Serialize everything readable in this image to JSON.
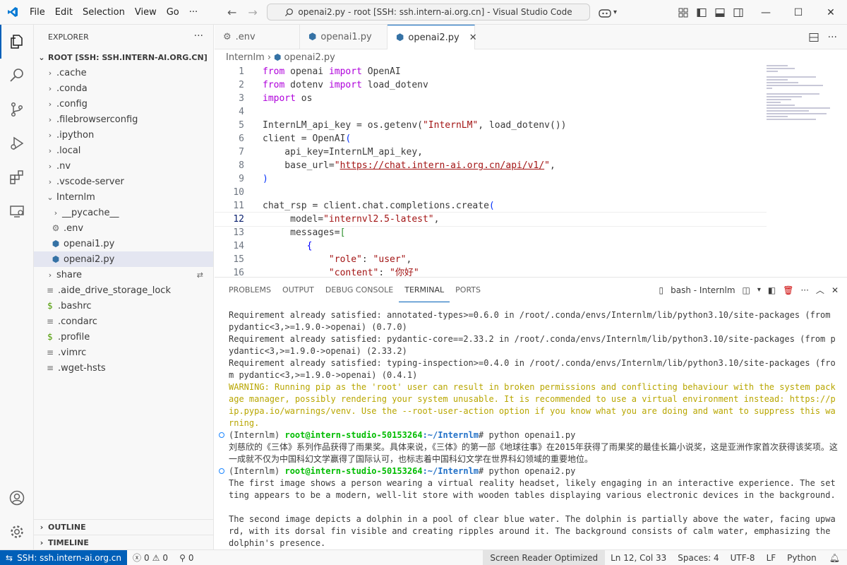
{
  "window": {
    "title": "openai2.py - root [SSH: ssh.intern-ai.org.cn] - Visual Studio Code",
    "menu": [
      "File",
      "Edit",
      "Selection",
      "View",
      "Go",
      "···"
    ]
  },
  "sidebar": {
    "header": "EXPLORER",
    "root_label": "ROOT [SSH: SSH.INTERN-AI.ORG.CN]",
    "items": [
      {
        "label": ".cache",
        "type": "folder",
        "depth": 1
      },
      {
        "label": ".conda",
        "type": "folder",
        "depth": 1
      },
      {
        "label": ".config",
        "type": "folder",
        "depth": 1
      },
      {
        "label": ".filebrowserconfig",
        "type": "folder",
        "depth": 1
      },
      {
        "label": ".ipython",
        "type": "folder",
        "depth": 1
      },
      {
        "label": ".local",
        "type": "folder",
        "depth": 1
      },
      {
        "label": ".nv",
        "type": "folder",
        "depth": 1
      },
      {
        "label": ".vscode-server",
        "type": "folder",
        "depth": 1
      },
      {
        "label": "Internlm",
        "type": "folder-open",
        "depth": 1
      },
      {
        "label": "__pycache__",
        "type": "folder",
        "depth": 2
      },
      {
        "label": ".env",
        "type": "gear-file",
        "depth": 2
      },
      {
        "label": "openai1.py",
        "type": "python",
        "depth": 2
      },
      {
        "label": "openai2.py",
        "type": "python",
        "depth": 2,
        "selected": true
      },
      {
        "label": "share",
        "type": "folder",
        "depth": 1
      },
      {
        "label": ".aide_drive_storage_lock",
        "type": "text",
        "depth": 1
      },
      {
        "label": ".bashrc",
        "type": "shell",
        "depth": 1
      },
      {
        "label": ".condarc",
        "type": "text",
        "depth": 1
      },
      {
        "label": ".profile",
        "type": "shell",
        "depth": 1
      },
      {
        "label": ".vimrc",
        "type": "text",
        "depth": 1
      },
      {
        "label": ".wget-hsts",
        "type": "text",
        "depth": 1
      }
    ],
    "outline": "OUTLINE",
    "timeline": "TIMELINE"
  },
  "tabs": [
    {
      "label": ".env",
      "icon": "gear-icon"
    },
    {
      "label": "openai1.py",
      "icon": "python-icon"
    },
    {
      "label": "openai2.py",
      "icon": "python-icon",
      "active": true
    }
  ],
  "breadcrumb": {
    "folder": "Internlm",
    "file": "openai2.py"
  },
  "code": {
    "current_line": 12
  },
  "panel": {
    "tabs": [
      "PROBLEMS",
      "OUTPUT",
      "DEBUG CONSOLE",
      "TERMINAL",
      "PORTS"
    ],
    "active_tab": "TERMINAL",
    "terminal_name": "bash - Internlm"
  },
  "terminal": {
    "lines": [
      "Requirement already satisfied: annotated-types>=0.6.0 in /root/.conda/envs/Internlm/lib/python3.10/site-packages (from pydantic<3,>=1.9.0->openai) (0.7.0)",
      "Requirement already satisfied: pydantic-core==2.33.2 in /root/.conda/envs/Internlm/lib/python3.10/site-packages (from pydantic<3,>=1.9.0->openai) (2.33.2)",
      "Requirement already satisfied: typing-inspection>=0.4.0 in /root/.conda/envs/Internlm/lib/python3.10/site-packages (from pydantic<3,>=1.9.0->openai) (0.4.1)"
    ],
    "warning": "WARNING: Running pip as the 'root' user can result in broken permissions and conflicting behaviour with the system package manager, possibly rendering your system unusable. It is recommended to use a virtual environment instead: https://pip.pypa.io/warnings/venv. Use the --root-user-action option if you know what you are doing and want to suppress this warning.",
    "prompt_env": "(Internlm) ",
    "prompt_user": "root@intern-studio-50153264",
    "prompt_path": ":~/Internlm",
    "cmd1": "# python openai1.py",
    "out1": "刘慈欣的《三体》系列作品获得了雨果奖。具体来说，《三体》的第一部《地球往事》在2015年获得了雨果奖的最佳长篇小说奖，这是亚洲作家首次获得该奖项。这一成就不仅为中国科幻文学赢得了国际认可，也标志着中国科幻文学在世界科幻领域的重要地位。",
    "cmd2": "# python openai2.py",
    "out2a": "The first image shows a person wearing a virtual reality headset, likely engaging in an interactive experience. The setting appears to be a modern, well-lit store with wooden tables displaying various electronic devices in the background.",
    "out2b": "The second image depicts a dolphin in a pool of clear blue water. The dolphin is partially above the water, facing upward, with its dorsal fin visible and creating ripples around it. The background consists of calm water, emphasizing the dolphin's presence.",
    "cmd3": "#"
  },
  "statusbar": {
    "remote": "SSH: ssh.intern-ai.org.cn",
    "errors": "0",
    "warnings": "0",
    "ports": "0",
    "screen_reader": "Screen Reader Optimized",
    "position": "Ln 12, Col 33",
    "spaces": "Spaces: 4",
    "encoding": "UTF-8",
    "eol": "LF",
    "language": "Python"
  },
  "colors": {
    "accent": "#005fb8",
    "python_icon": "#3572a5"
  }
}
